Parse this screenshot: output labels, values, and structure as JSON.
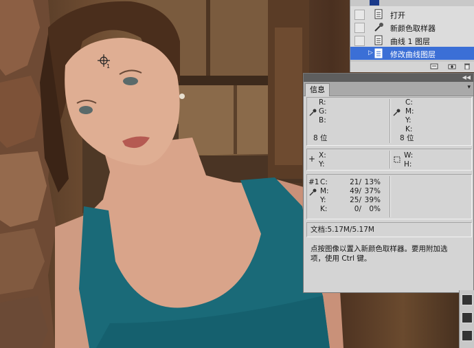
{
  "history": {
    "items": [
      {
        "label": "打开",
        "icon": "document-icon"
      },
      {
        "label": "新颜色取样器",
        "icon": "color-sampler-icon"
      },
      {
        "label": "曲线 1 图层",
        "icon": "document-icon"
      },
      {
        "label": "修改曲线图层",
        "icon": "document-icon",
        "selected": true
      }
    ]
  },
  "info": {
    "tab_label": "信息",
    "rgb": {
      "r": "R:",
      "g": "G:",
      "b": "B:",
      "bits": "8 位"
    },
    "cmyk": {
      "c": "C:",
      "m": "M:",
      "y": "Y:",
      "k": "K:",
      "bits": "8 位"
    },
    "xy": {
      "x": "X:",
      "y": "Y:"
    },
    "wh": {
      "w": "W:",
      "h": "H:"
    },
    "sampler": {
      "id": "#1",
      "rows": [
        {
          "ch": "C:",
          "v1": "21/",
          "v2": "13%"
        },
        {
          "ch": "M:",
          "v1": "49/",
          "v2": "37%"
        },
        {
          "ch": "Y:",
          "v1": "25/",
          "v2": "39%"
        },
        {
          "ch": "K:",
          "v1": "0/",
          "v2": "0%"
        }
      ]
    },
    "doc_size": "文档:5.17M/5.17M",
    "hint_line1": "点按图像以置入新颜色取样器。要用附加选",
    "hint_line2": "项，使用 Ctrl 键。"
  },
  "canvas": {
    "sampler_marker_label": "1"
  },
  "colors": {
    "selection": "#3b6fd6",
    "panel_bg": "#d4d4d4",
    "top_color": "#1a6a78"
  }
}
